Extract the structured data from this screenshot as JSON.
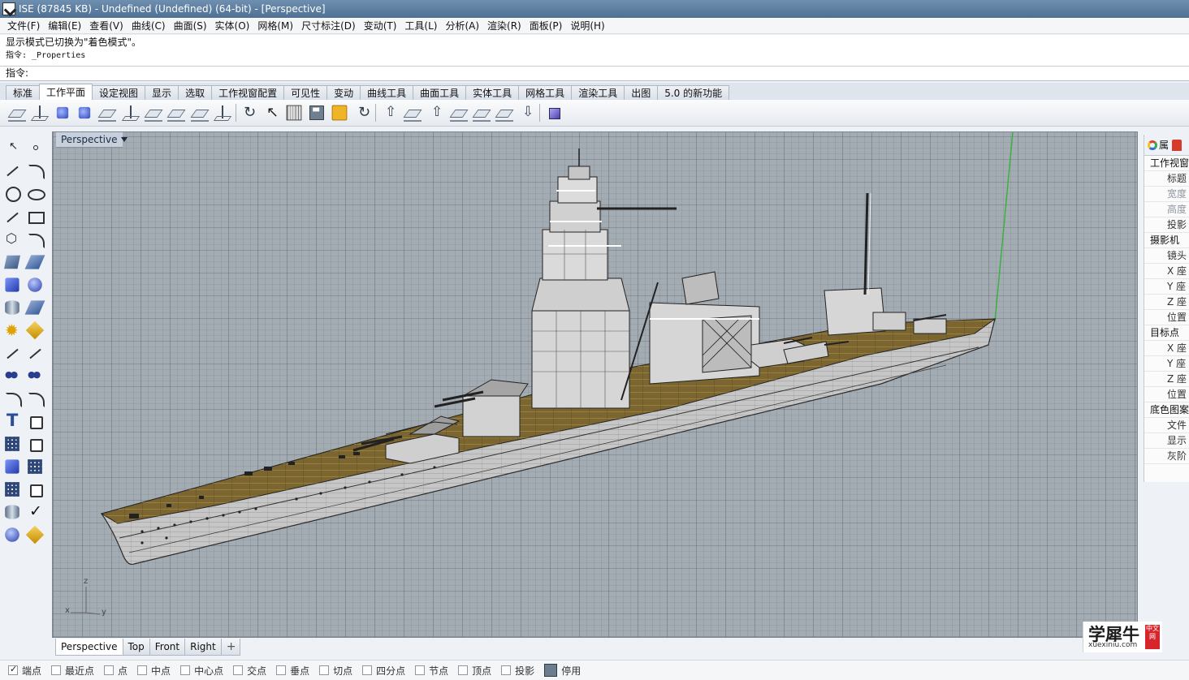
{
  "window": {
    "title": "ISE (87845 KB) - Undefined (Undefined) (64-bit) - [Perspective]"
  },
  "menu": [
    "文件(F)",
    "编辑(E)",
    "查看(V)",
    "曲线(C)",
    "曲面(S)",
    "实体(O)",
    "网格(M)",
    "尺寸标注(D)",
    "变动(T)",
    "工具(L)",
    "分析(A)",
    "渲染(R)",
    "面板(P)",
    "说明(H)"
  ],
  "command": {
    "history1": "显示模式已切换为\"着色模式\"。",
    "history2": "指令: _Properties",
    "prompt": "指令:"
  },
  "tabs": [
    "标准",
    "工作平面",
    "设定视图",
    "显示",
    "选取",
    "工作视窗配置",
    "可见性",
    "变动",
    "曲线工具",
    "曲面工具",
    "实体工具",
    "网格工具",
    "渲染工具",
    "出图",
    "5.0 的新功能"
  ],
  "active_tab_index": 1,
  "viewport": {
    "label": "Perspective",
    "axis": {
      "z": "z",
      "x": "x",
      "y": "y"
    }
  },
  "viewport_tabs": [
    "Perspective",
    "Top",
    "Front",
    "Right"
  ],
  "viewport_tab_add": "+",
  "right_panel": {
    "tab_label": "属",
    "rows": [
      {
        "type": "section",
        "text": "工作视窗"
      },
      {
        "type": "field",
        "text": "标题"
      },
      {
        "type": "field",
        "text": "宽度",
        "dim": true
      },
      {
        "type": "field",
        "text": "高度",
        "dim": true
      },
      {
        "type": "field",
        "text": "投影"
      },
      {
        "type": "section",
        "text": "摄影机"
      },
      {
        "type": "field",
        "text": "镜头"
      },
      {
        "type": "field",
        "text": "X 座"
      },
      {
        "type": "field",
        "text": "Y 座"
      },
      {
        "type": "field",
        "text": "Z 座"
      },
      {
        "type": "field",
        "text": "位置"
      },
      {
        "type": "section",
        "text": "目标点"
      },
      {
        "type": "field",
        "text": "X 座"
      },
      {
        "type": "field",
        "text": "Y 座"
      },
      {
        "type": "field",
        "text": "Z 座"
      },
      {
        "type": "field",
        "text": "位置"
      },
      {
        "type": "section",
        "text": "底色图案"
      },
      {
        "type": "field",
        "text": "文件"
      },
      {
        "type": "field",
        "text": "显示"
      },
      {
        "type": "field",
        "text": "灰阶"
      }
    ]
  },
  "osnaps": [
    {
      "label": "端点",
      "checked": true
    },
    {
      "label": "最近点",
      "checked": false
    },
    {
      "label": "点",
      "checked": false
    },
    {
      "label": "中点",
      "checked": false
    },
    {
      "label": "中心点",
      "checked": false
    },
    {
      "label": "交点",
      "checked": false
    },
    {
      "label": "垂点",
      "checked": false
    },
    {
      "label": "切点",
      "checked": false
    },
    {
      "label": "四分点",
      "checked": false
    },
    {
      "label": "节点",
      "checked": false
    },
    {
      "label": "顶点",
      "checked": false
    },
    {
      "label": "投影",
      "checked": false
    },
    {
      "label": "停用",
      "checked": false,
      "dark": true
    }
  ],
  "watermark": {
    "main": "学犀牛",
    "sub": "xuexiniu.com",
    "seal": "中文网"
  },
  "colors": {
    "titlebar": "#5c7fa3",
    "deck": "#7b6531",
    "hull": "#c8c8c8",
    "grid": "#a3abb3"
  }
}
